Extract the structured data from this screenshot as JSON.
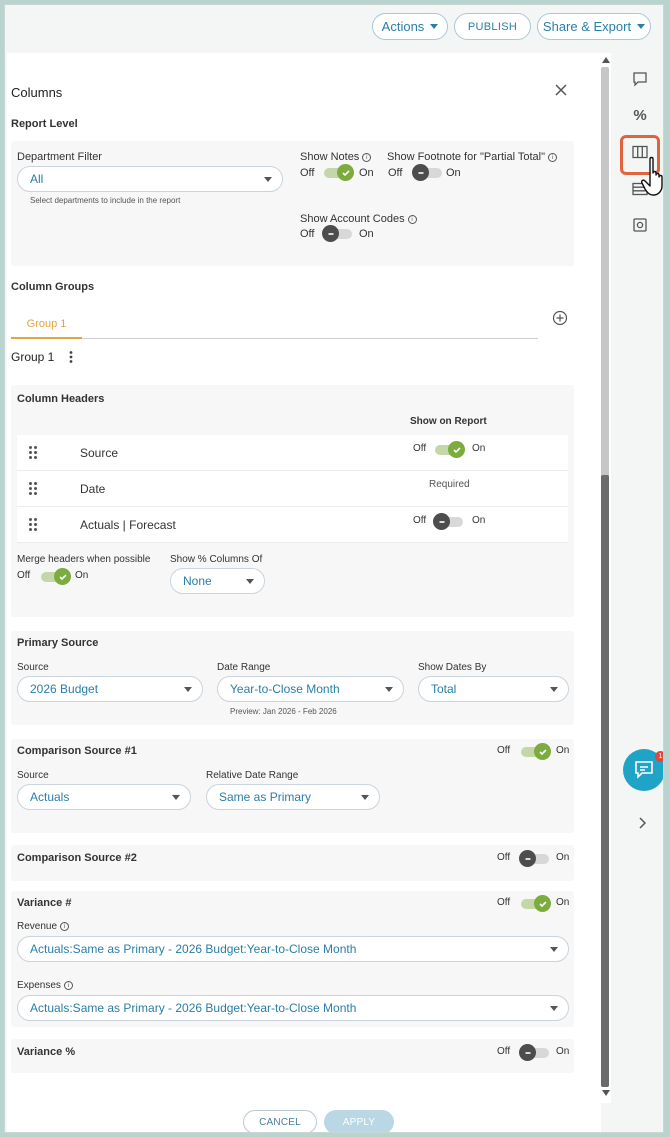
{
  "toolbar": {
    "actions_label": "Actions",
    "publish_label": "PUBLISH",
    "share_label": "Share & Export"
  },
  "panel": {
    "title": "Columns",
    "report_level": {
      "heading": "Report Level",
      "department_filter": {
        "label": "Department Filter",
        "value": "All",
        "hint": "Select departments to include in the report"
      },
      "show_notes": {
        "label": "Show Notes",
        "off": "Off",
        "on": "On",
        "state": "on"
      },
      "show_footnote": {
        "label": "Show Footnote for \"Partial Total\"",
        "off": "Off",
        "on": "On",
        "state": "off"
      },
      "show_account_codes": {
        "label": "Show Account Codes",
        "off": "Off",
        "on": "On",
        "state": "off"
      }
    },
    "column_groups": {
      "heading": "Column Groups",
      "tabs": [
        {
          "label": "Group 1"
        }
      ],
      "group_name": "Group 1"
    },
    "column_headers": {
      "heading": "Column Headers",
      "show_on_report_label": "Show on Report",
      "rows": [
        {
          "name": "Source",
          "off": "Off",
          "on": "On",
          "state": "on"
        },
        {
          "name": "Date",
          "status": "Required"
        },
        {
          "name": "Actuals | Forecast",
          "off": "Off",
          "on": "On",
          "state": "off"
        }
      ],
      "merge_headers": {
        "label": "Merge headers when possible",
        "off": "Off",
        "on": "On",
        "state": "on"
      },
      "show_pct_columns": {
        "label": "Show % Columns Of",
        "value": "None"
      }
    },
    "primary_source": {
      "heading": "Primary Source",
      "source_label": "Source",
      "source_value": "2026 Budget",
      "date_range_label": "Date Range",
      "date_range_value": "Year-to-Close Month",
      "preview": "Preview: Jan 2026 - Feb 2026",
      "show_dates_label": "Show Dates By",
      "show_dates_value": "Total"
    },
    "comparison1": {
      "heading": "Comparison Source #1",
      "off": "Off",
      "on": "On",
      "state": "on",
      "source_label": "Source",
      "source_value": "Actuals",
      "relative_label": "Relative Date Range",
      "relative_value": "Same as Primary"
    },
    "comparison2": {
      "heading": "Comparison Source #2",
      "off": "Off",
      "on": "On",
      "state": "off"
    },
    "variance_num": {
      "heading": "Variance #",
      "off": "Off",
      "on": "On",
      "state": "on",
      "revenue_label": "Revenue",
      "revenue_value": "Actuals:Same as Primary - 2026 Budget:Year-to-Close Month",
      "expenses_label": "Expenses",
      "expenses_value": "Actuals:Same as Primary - 2026 Budget:Year-to-Close Month"
    },
    "variance_pct": {
      "heading": "Variance %",
      "off": "Off",
      "on": "On",
      "state": "off"
    },
    "footer": {
      "cancel_label": "CANCEL",
      "apply_label": "APPLY"
    }
  },
  "rail": {
    "icons": [
      "comment-icon",
      "percent-icon",
      "columns-icon",
      "rows-icon",
      "settings-icon",
      "chevron-right-icon"
    ],
    "chat_badge": "1"
  },
  "colors": {
    "accent": "#2a7ea8",
    "toggle_on": "#7cac3e",
    "tab_active": "#e8a33a",
    "highlight": "#e2643e"
  }
}
